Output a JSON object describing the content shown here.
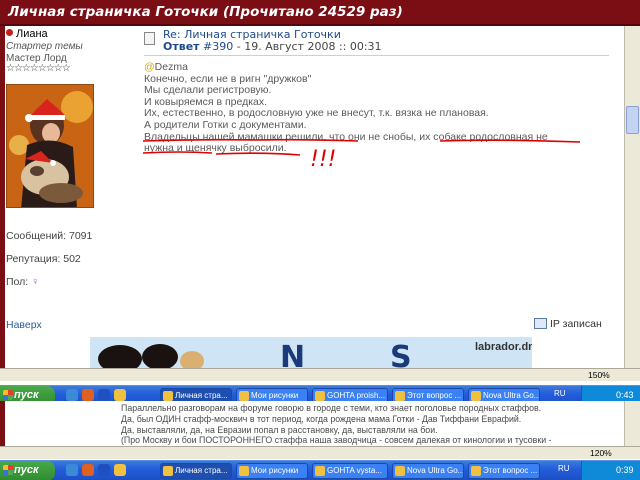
{
  "header": {
    "title": "Личная страничка Готочки (Прочитано 24529 раз)"
  },
  "user": {
    "name": "Лиана",
    "rank": "Стартер темы",
    "title": "Мастер Лорд",
    "stars": "☆☆☆☆☆☆☆☆",
    "posts": "Сообщений: 7091",
    "reputation": "Репутация: 502",
    "gender_label": "Пол:",
    "gender_icon": "female-icon"
  },
  "post": {
    "subject": "Re: Личная страничка Готочки",
    "reply_label": "Ответ",
    "reply_num": "#390",
    "date": "- 19. Август 2008 :: 00:31",
    "mention_at": "@",
    "mention_name": "Dezma",
    "lines": [
      "Конечно, если не в ригн \"дружков\"",
      "Мы сделали регистровую.",
      "И ковыряемся в предках.",
      "Их, естественно, в родословную уже не внесут, т.к. вязка не плановая.",
      "А родители Готки с документами.",
      "Владельцы нашей мамашки решили, что они не снобы, их собаке родословная не",
      "нужна и щенячку выбросили."
    ],
    "annotation": "!!!"
  },
  "footer": {
    "top_link": "Наверх",
    "ip_label": "IP записан"
  },
  "banner": {
    "text": "labrador.dn.ua"
  },
  "taskbar_top": {
    "start": "пуск",
    "items": [
      "Личная стра...",
      "Мои рисунки",
      "GOHTA proish...",
      "Этот вопрос ...",
      "Nova Ultra Go..."
    ],
    "lang": "RU",
    "time": "0:43",
    "zoom": "150%"
  },
  "lower_window": {
    "lines": [
      "Параллельно разговорам на форуме говорю в городе с теми, кто знает поголовье породных стаффов.",
      "Да, был ОДИН стафф-москвич в тот период, когда рождена мама Готки - Дав Тиффани Еврафий.",
      "Да, выставляли, да, на Евразии попал в расстановку, да, выставляли на бои.",
      "(Про Москву и бои ПОСТОРОННЕГО стаффа наша заводчица - совсем далекая от кинологии и тусовки -"
    ]
  },
  "taskbar_bottom": {
    "start": "пуск",
    "items": [
      "Личная стра...",
      "Мои рисунки",
      "GOHTA vysta...",
      "Nova Ultra Go...",
      "Этот вопрос ..."
    ],
    "lang": "RU",
    "time": "0:39",
    "zoom": "120%"
  },
  "colors": {
    "title_bar": "#7a0e14",
    "link": "#1d4a8c",
    "underline": "#e00000",
    "taskbar": "#245edb"
  }
}
